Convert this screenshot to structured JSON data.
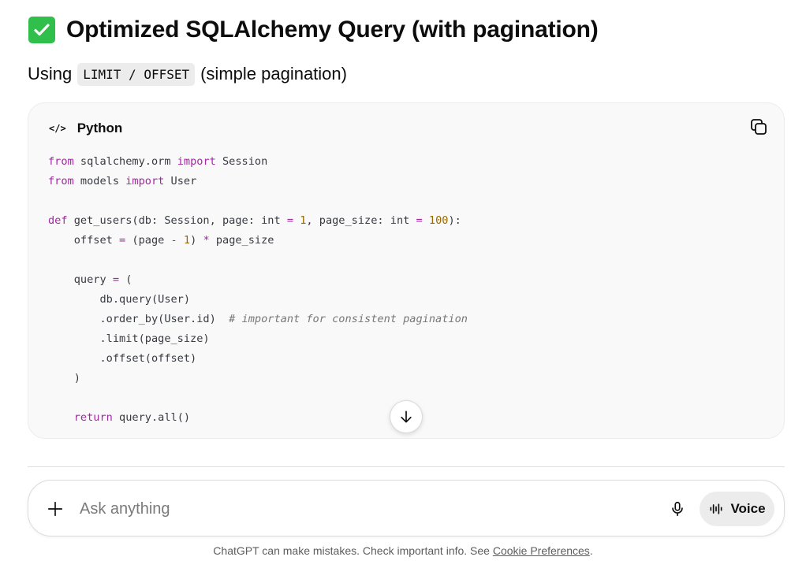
{
  "heading": {
    "icon": "check-mark-button-icon",
    "icon_color": "#2fbf4a",
    "text": "Optimized SQLAlchemy Query (with pagination)"
  },
  "subheading": {
    "lead": "Using",
    "code": "LIMIT / OFFSET",
    "tail": "(simple pagination)"
  },
  "code_block": {
    "language": "Python",
    "lang_icon": "</>",
    "lines": [
      "from sqlalchemy.orm import Session",
      "from models import User",
      "",
      "def get_users(db: Session, page: int = 1, page_size: int = 100):",
      "    offset = (page - 1) * page_size",
      "",
      "    query = (",
      "        db.query(User)",
      "        .order_by(User.id)  # important for consistent pagination",
      "        .limit(page_size)",
      "        .offset(offset)",
      "    )",
      "",
      "    return query.all()"
    ]
  },
  "composer": {
    "placeholder": "Ask anything",
    "voice_label": "Voice"
  },
  "footer": {
    "text": "ChatGPT can make mistakes. Check important info. See ",
    "link": "Cookie Preferences",
    "end": "."
  }
}
